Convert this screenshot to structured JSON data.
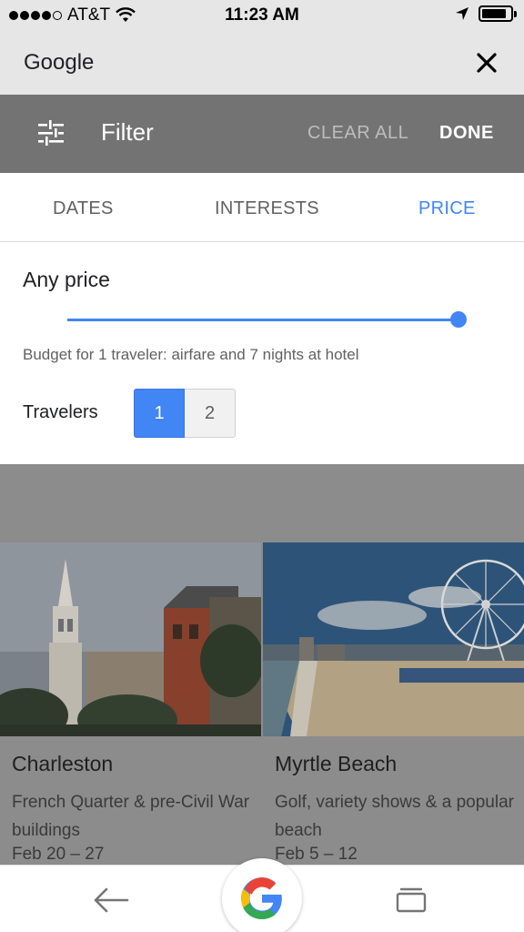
{
  "status_bar": {
    "carrier": "AT&T",
    "time": "11:23 AM",
    "signal_bars": 4,
    "battery_level": 0.85,
    "icons": [
      "wifi-icon",
      "location-arrow-icon",
      "battery-icon"
    ]
  },
  "app_header": {
    "title": "Google",
    "close_icon": "close-icon"
  },
  "filter_bar": {
    "title": "Filter",
    "filter_icon": "filter-sliders-icon",
    "clear_all_label": "CLEAR ALL",
    "done_label": "DONE"
  },
  "tabs": [
    {
      "label": "DATES",
      "active": false
    },
    {
      "label": "INTERESTS",
      "active": false
    },
    {
      "label": "PRICE",
      "active": true
    }
  ],
  "price": {
    "label": "Any price",
    "slider_value": 1.0,
    "budget_text": "Budget for 1 traveler: airfare and 7 nights at hotel",
    "travelers_label": "Travelers",
    "traveler_options": [
      "1",
      "2"
    ],
    "selected_travelers": "1"
  },
  "results": [
    {
      "title": "Charleston",
      "description": "French Quarter & pre-Civil War buildings",
      "dates": "Feb 20 – 27",
      "image": "charleston-church-photo"
    },
    {
      "title": "Myrtle Beach",
      "description": "Golf, variety shows & a popular beach",
      "dates": "Feb 5 – 12",
      "image": "myrtle-beach-ferris-wheel-photo"
    }
  ],
  "bottom_nav": {
    "back_icon": "back-arrow-icon",
    "home_icon": "google-g-icon",
    "tabs_icon": "tabs-icon"
  },
  "colors": {
    "accent": "#4285f4",
    "toolbar": "#737373",
    "header": "#e6e6e6",
    "overlay": "#8c8c8c"
  }
}
